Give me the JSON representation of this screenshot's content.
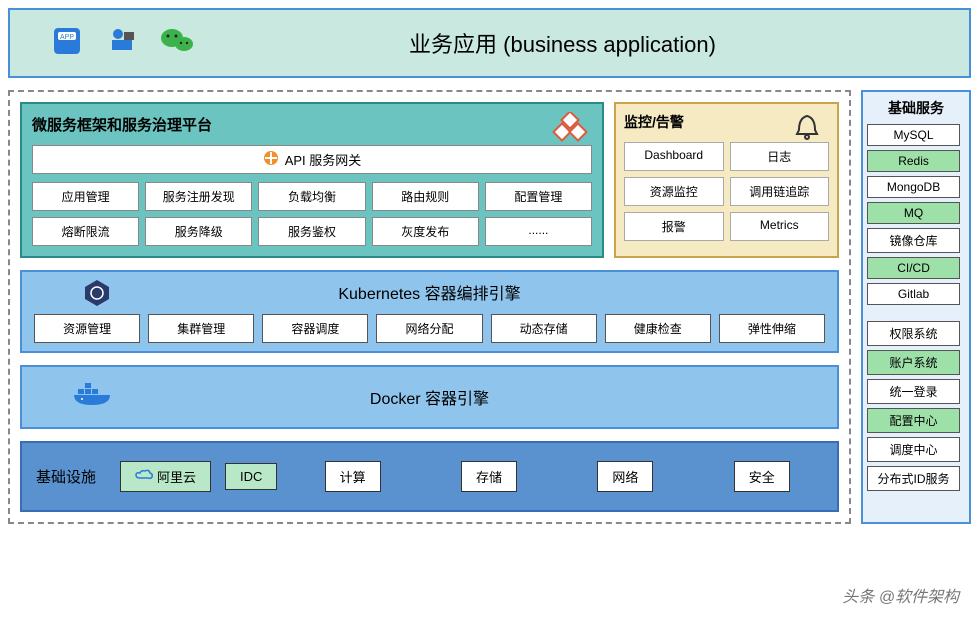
{
  "top": {
    "title": "业务应用 (business application)"
  },
  "micro": {
    "title": "微服务框架和服务治理平台",
    "api_gateway": "API 服务网关",
    "cells": [
      "应用管理",
      "服务注册发现",
      "负载均衡",
      "路由规则",
      "配置管理",
      "熔断限流",
      "服务降级",
      "服务鉴权",
      "灰度发布",
      "......"
    ]
  },
  "alert": {
    "title": "监控/告警",
    "cells": [
      "Dashboard",
      "日志",
      "资源监控",
      "调用链追踪",
      "报警",
      "Metrics"
    ]
  },
  "k8s": {
    "title": "Kubernetes 容器编排引擎",
    "cells": [
      "资源管理",
      "集群管理",
      "容器调度",
      "网络分配",
      "动态存储",
      "健康检查",
      "弹性伸缩"
    ]
  },
  "docker": {
    "title": "Docker 容器引擎"
  },
  "infra": {
    "title": "基础设施",
    "aliyun": "阿里云",
    "idc": "IDC",
    "cells": [
      "计算",
      "存储",
      "网络",
      "安全"
    ]
  },
  "basic": {
    "title": "基础服务",
    "group1": [
      {
        "label": "MySQL",
        "green": false
      },
      {
        "label": "Redis",
        "green": true
      },
      {
        "label": "MongoDB",
        "green": false
      },
      {
        "label": "MQ",
        "green": true
      },
      {
        "label": "镜像仓库",
        "green": false
      },
      {
        "label": "CI/CD",
        "green": true
      },
      {
        "label": "Gitlab",
        "green": false
      }
    ],
    "group2": [
      {
        "label": "权限系统",
        "green": false
      },
      {
        "label": "账户系统",
        "green": true
      },
      {
        "label": "统一登录",
        "green": false
      },
      {
        "label": "配置中心",
        "green": true
      },
      {
        "label": "调度中心",
        "green": false
      },
      {
        "label": "分布式ID服务",
        "green": false
      }
    ]
  },
  "watermark": "头条 @软件架构"
}
